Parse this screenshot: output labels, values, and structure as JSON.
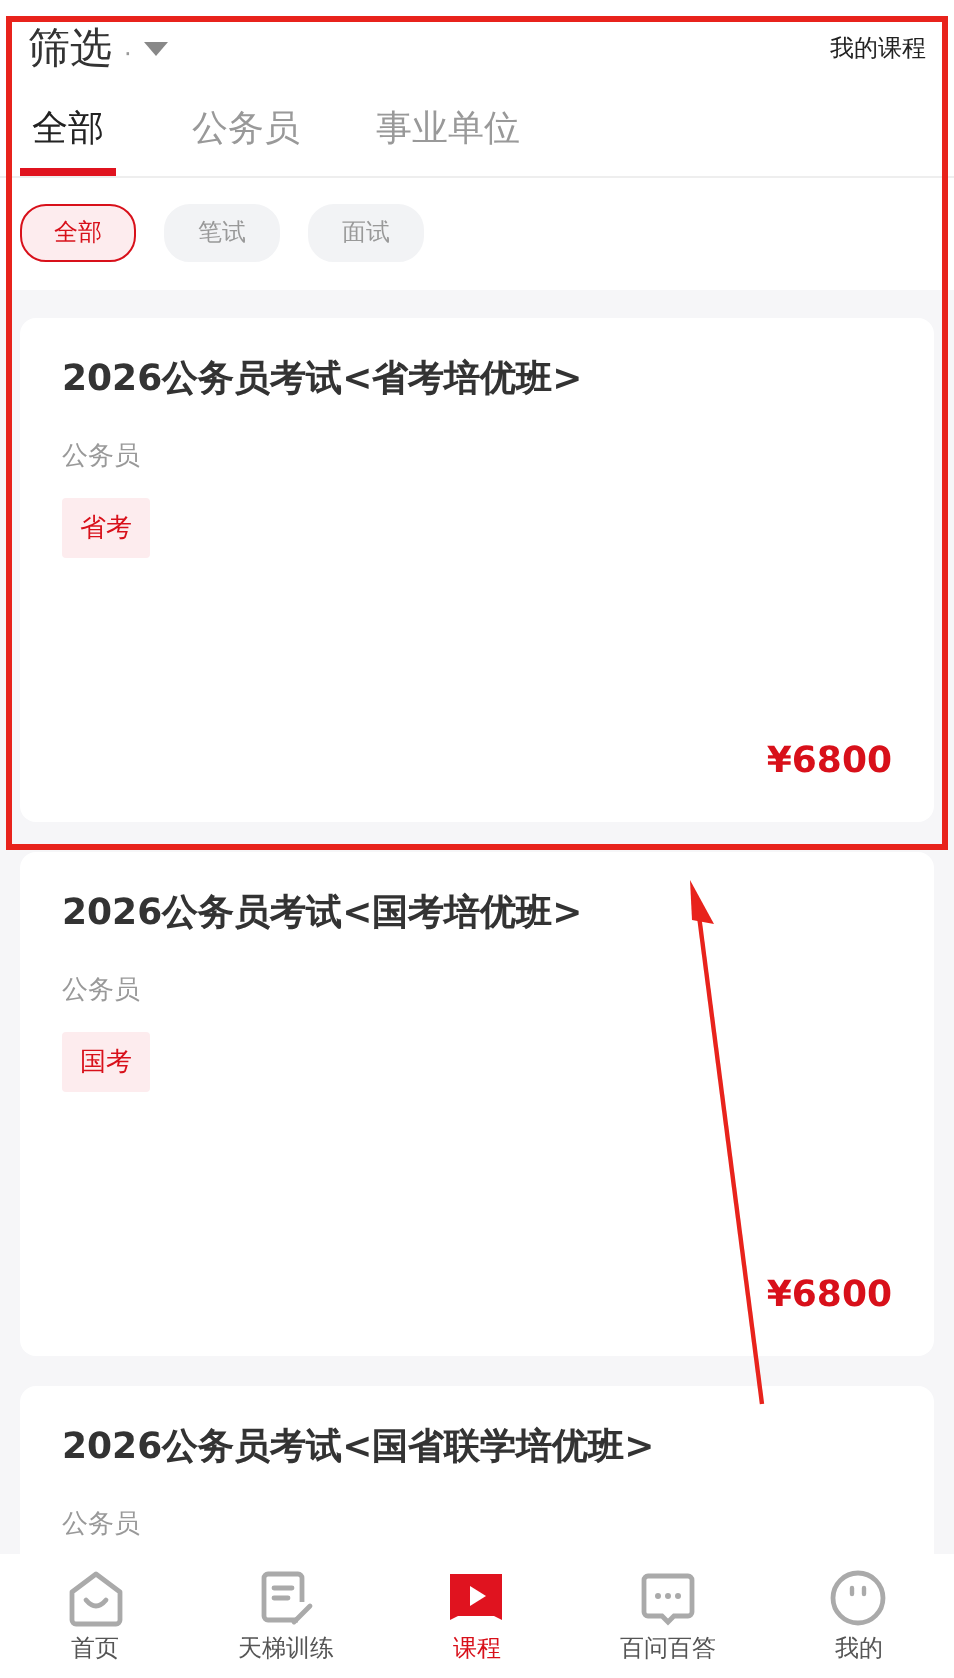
{
  "header": {
    "title": "筛选",
    "dot": "·",
    "link": "我的课程"
  },
  "tabs": [
    {
      "label": "全部",
      "selected": true
    },
    {
      "label": "公务员",
      "selected": false
    },
    {
      "label": "事业单位",
      "selected": false
    }
  ],
  "chips": [
    {
      "label": "全部",
      "selected": true
    },
    {
      "label": "笔试",
      "selected": false
    },
    {
      "label": "面试",
      "selected": false
    }
  ],
  "courses": [
    {
      "title": "2026公务员考试<省考培优班>",
      "category": "公务员",
      "tag": "省考",
      "price": "¥6800"
    },
    {
      "title": "2026公务员考试<国考培优班>",
      "category": "公务员",
      "tag": "国考",
      "price": "¥6800"
    },
    {
      "title": "2026公务员考试<国省联学培优班>",
      "category": "公务员"
    }
  ],
  "nav": [
    {
      "kind": "home",
      "label": "首页",
      "selected": false
    },
    {
      "kind": "note",
      "label": "天梯训练",
      "selected": false
    },
    {
      "kind": "play",
      "label": "课程",
      "selected": true
    },
    {
      "kind": "chat",
      "label": "百问百答",
      "selected": false
    },
    {
      "kind": "face",
      "label": "我的",
      "selected": false
    }
  ]
}
